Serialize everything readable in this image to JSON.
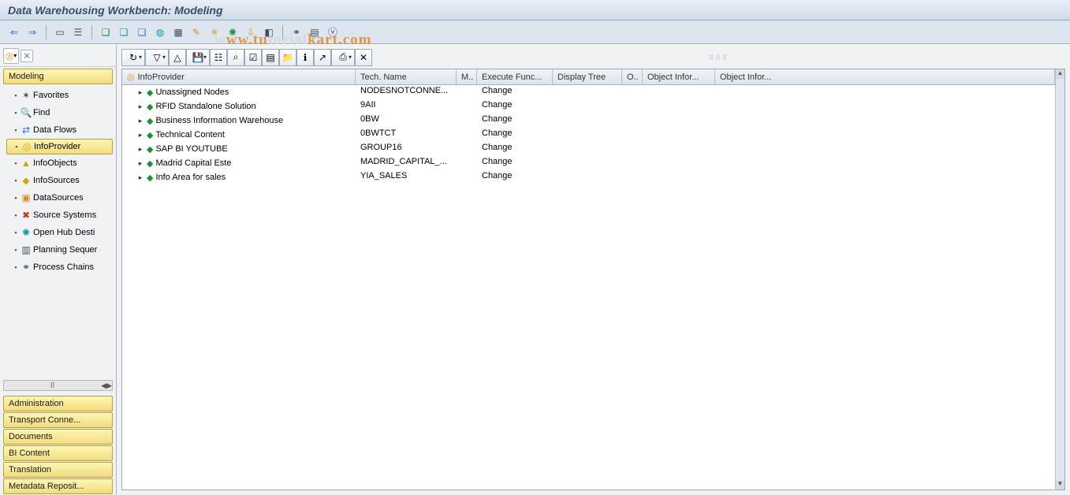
{
  "title": "Data Warehousing Workbench: Modeling",
  "watermark": "www.tutorialkart.com",
  "app_toolbar": [
    {
      "name": "back-icon",
      "glyph": "⇐",
      "cls": "c-blue"
    },
    {
      "name": "forward-icon",
      "glyph": "⇒",
      "cls": "c-blue"
    },
    {
      "name": "sep"
    },
    {
      "name": "window-icon",
      "glyph": "▭",
      "cls": "c-dark"
    },
    {
      "name": "tree-icon",
      "glyph": "☰",
      "cls": "c-dark"
    },
    {
      "name": "sep"
    },
    {
      "name": "cube-green-icon",
      "glyph": "❏",
      "cls": "c-green"
    },
    {
      "name": "cube-teal-icon",
      "glyph": "❏",
      "cls": "c-teal"
    },
    {
      "name": "cube-blue-icon",
      "glyph": "❏",
      "cls": "c-blue"
    },
    {
      "name": "cylinder-icon",
      "glyph": "◍",
      "cls": "c-teal"
    },
    {
      "name": "grid-icon",
      "glyph": "▦",
      "cls": "c-dark"
    },
    {
      "name": "wand-icon",
      "glyph": "✎",
      "cls": "c-orange"
    },
    {
      "name": "gear-icon",
      "glyph": "✳",
      "cls": "c-yellow"
    },
    {
      "name": "spark-icon",
      "glyph": "✺",
      "cls": "c-green"
    },
    {
      "name": "download-icon",
      "glyph": "⇩",
      "cls": "c-yellow"
    },
    {
      "name": "tag-icon",
      "glyph": "◧",
      "cls": "c-dark"
    },
    {
      "name": "sep"
    },
    {
      "name": "link-icon",
      "glyph": "⚭",
      "cls": "c-dark"
    },
    {
      "name": "db-icon",
      "glyph": "▤",
      "cls": "c-dark"
    },
    {
      "name": "var-icon",
      "glyph": "ⓥ",
      "cls": "c-dark"
    }
  ],
  "sidebar": {
    "top_section": "Modeling",
    "items": [
      {
        "icon": "✶",
        "icon_cls": "c-dark",
        "label": "Favorites",
        "name": "nav-favorites"
      },
      {
        "icon": "🔍",
        "icon_cls": "c-dark",
        "label": "Find",
        "name": "nav-find"
      },
      {
        "icon": "⇄",
        "icon_cls": "c-blue",
        "label": "Data Flows",
        "name": "nav-data-flows"
      },
      {
        "icon": "◎",
        "icon_cls": "c-yellow",
        "label": "InfoProvider",
        "name": "nav-infoprovider",
        "selected": true
      },
      {
        "icon": "▲",
        "icon_cls": "c-yellow",
        "label": "InfoObjects",
        "name": "nav-infoobjects"
      },
      {
        "icon": "◆",
        "icon_cls": "c-yellow",
        "label": "InfoSources",
        "name": "nav-infosources"
      },
      {
        "icon": "▣",
        "icon_cls": "c-orange",
        "label": "DataSources",
        "name": "nav-datasources"
      },
      {
        "icon": "✖",
        "icon_cls": "c-red",
        "label": "Source Systems",
        "name": "nav-source-systems"
      },
      {
        "icon": "✺",
        "icon_cls": "c-teal",
        "label": "Open Hub Desti",
        "name": "nav-open-hub"
      },
      {
        "icon": "▥",
        "icon_cls": "c-dark",
        "label": "Planning Sequer",
        "name": "nav-planning-seq"
      },
      {
        "icon": "⚭",
        "icon_cls": "c-dark",
        "label": "Process Chains",
        "name": "nav-process-chains"
      }
    ],
    "bottom": [
      {
        "label": "Administration",
        "name": "acc-administration"
      },
      {
        "label": "Transport Conne...",
        "name": "acc-transport-connection"
      },
      {
        "label": "Documents",
        "name": "acc-documents"
      },
      {
        "label": "BI Content",
        "name": "acc-bi-content"
      },
      {
        "label": "Translation",
        "name": "acc-translation"
      },
      {
        "label": "Metadata Reposit...",
        "name": "acc-metadata-repository"
      }
    ]
  },
  "main_toolbar": [
    {
      "name": "refresh-icon",
      "glyph": "↻",
      "split": true
    },
    {
      "name": "filter-icon",
      "glyph": "▽",
      "split": true
    },
    {
      "name": "sort-asc-icon",
      "glyph": "△"
    },
    {
      "name": "save-icon",
      "glyph": "💾",
      "split": true
    },
    {
      "name": "hierarchy-icon",
      "glyph": "☷"
    },
    {
      "name": "find-icon",
      "glyph": "⌕"
    },
    {
      "name": "select-icon",
      "glyph": "☑"
    },
    {
      "name": "columns-icon",
      "glyph": "▤"
    },
    {
      "name": "folder-icon",
      "glyph": "📁"
    },
    {
      "name": "info-icon",
      "glyph": "ℹ"
    },
    {
      "name": "external-icon",
      "glyph": "↗"
    },
    {
      "name": "print-icon",
      "glyph": "⎙",
      "split": true
    },
    {
      "name": "close-view-icon",
      "glyph": "✕"
    }
  ],
  "grid": {
    "headers": [
      "InfoProvider",
      "Tech. Name",
      "M..",
      "Execute Func...",
      "Display Tree",
      "O..",
      "Object Infor...",
      "Object Infor..."
    ],
    "header_icon": "◎",
    "rows": [
      {
        "label": "Unassigned Nodes",
        "tech": "NODESNOTCONNE...",
        "exec": "Change"
      },
      {
        "label": "RFID Standalone Solution",
        "tech": "9AII",
        "exec": "Change"
      },
      {
        "label": "Business Information Warehouse",
        "tech": "0BW",
        "exec": "Change"
      },
      {
        "label": "Technical Content",
        "tech": "0BWTCT",
        "exec": "Change"
      },
      {
        "label": "SAP BI YOUTUBE",
        "tech": "GROUP16",
        "exec": "Change"
      },
      {
        "label": "Madrid Capital Este",
        "tech": "MADRID_CAPITAL_...",
        "exec": "Change"
      },
      {
        "label": "Info Area for sales",
        "tech": "YIA_SALES",
        "exec": "Change"
      }
    ]
  }
}
